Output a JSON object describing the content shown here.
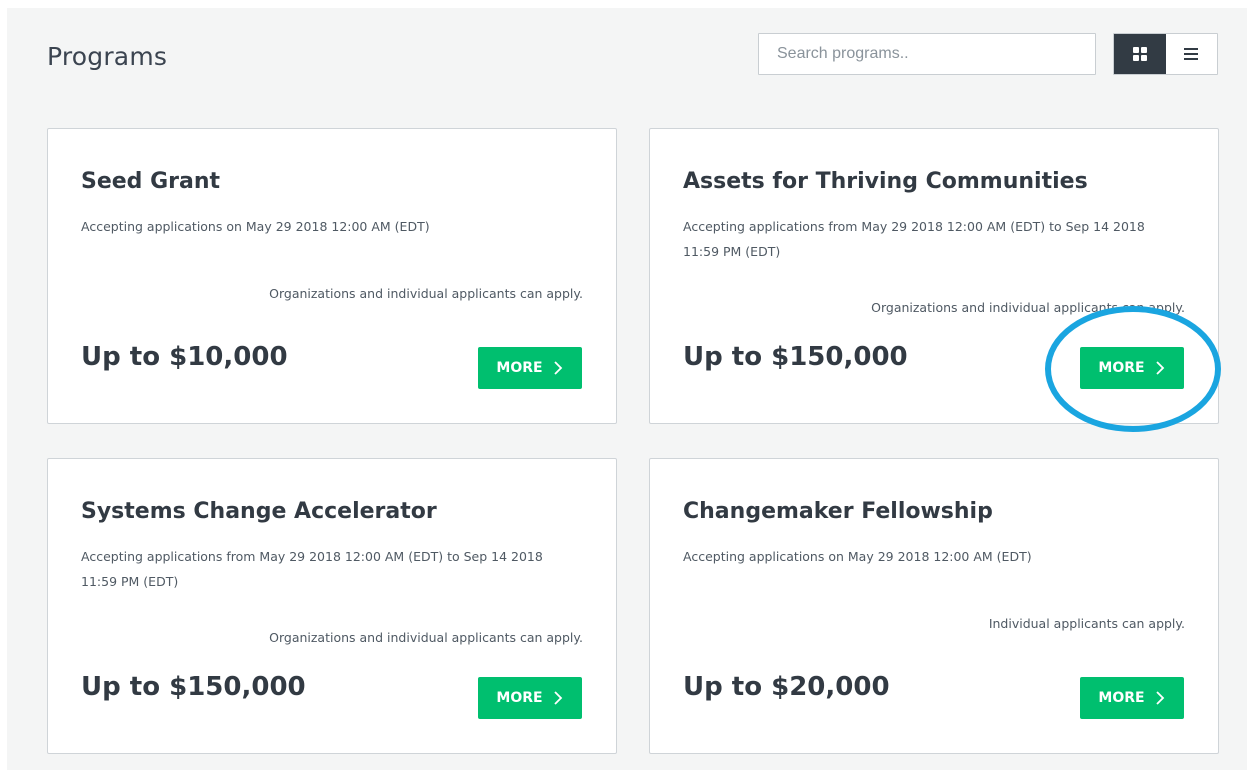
{
  "header": {
    "title": "Programs",
    "search_placeholder": "Search programs..",
    "grid_view_icon": "grid-icon",
    "list_view_icon": "list-icon"
  },
  "colors": {
    "accent": "#00bf6f",
    "dark": "#323b44",
    "highlight": "#1aa5e0"
  },
  "programs": [
    {
      "title": "Seed Grant",
      "dates": "Accepting applications on May 29 2018 12:00 AM (EDT)",
      "eligibility": "Organizations and individual applicants can apply.",
      "amount": "Up to $10,000",
      "button": "MORE"
    },
    {
      "title": "Assets for Thriving Communities",
      "dates": "Accepting applications from May 29 2018 12:00 AM (EDT) to Sep 14 2018 11:59 PM (EDT)",
      "eligibility": "Organizations and individual applicants can apply.",
      "amount": "Up to $150,000",
      "button": "MORE"
    },
    {
      "title": "Systems Change Accelerator",
      "dates": "Accepting applications from May 29 2018 12:00 AM (EDT) to Sep 14 2018 11:59 PM (EDT)",
      "eligibility": "Organizations and individual applicants can apply.",
      "amount": "Up to $150,000",
      "button": "MORE"
    },
    {
      "title": "Changemaker Fellowship",
      "dates": "Accepting applications on May 29 2018 12:00 AM (EDT)",
      "eligibility": "Individual applicants can apply.",
      "amount": "Up to $20,000",
      "button": "MORE"
    }
  ]
}
